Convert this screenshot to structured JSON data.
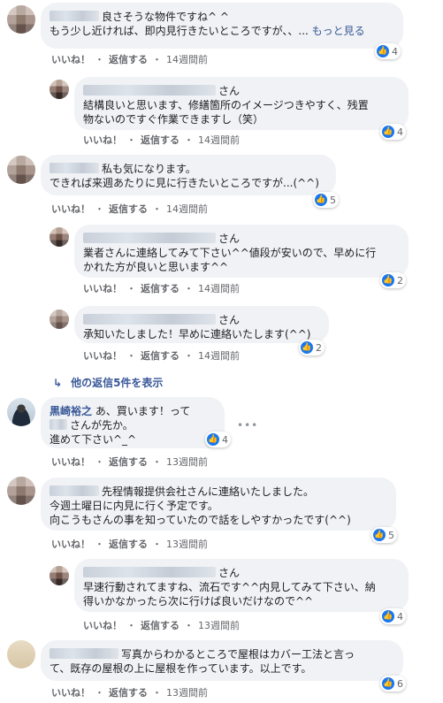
{
  "actions": {
    "like": "いいね！",
    "reply": "返信する",
    "sep": "・"
  },
  "comments": [
    {
      "name": "",
      "lines": [
        "良さそうな物件ですね^ ^",
        "もう少し近ければ、即内見行きたいところですが、、... "
      ],
      "see_more": "もっと見る",
      "likes": "4",
      "time": "14週間前"
    },
    {
      "name": "さん",
      "lines": [
        "結構良いと思います、修繕箇所のイメージつきやすく、残置",
        "物ないのですぐ作業できますし（笑）"
      ],
      "likes": "4",
      "time": "14週間前"
    },
    {
      "name": "",
      "lines": [
        "私も気になります。",
        "できれば来週あたりに見に行きたいところですが...(^^)"
      ],
      "likes": "5",
      "time": "14週間前"
    },
    {
      "name": "さん",
      "lines": [
        "業者さんに連絡してみて下さい^^値段が安いので、早めに行",
        "かれた方が良いと思います^^"
      ],
      "likes": "2",
      "time": "14週間前"
    },
    {
      "name": "さん",
      "lines": [
        "承知いたしました！早めに連絡いたします(^^)"
      ],
      "likes": "2",
      "time": "14週間前"
    },
    {
      "name": "黒崎裕之",
      "lines": [
        "あ、買います！って",
        "さんが先か。",
        "進めて下さい^_^"
      ],
      "likes": "4",
      "time": "13週間前"
    },
    {
      "name": "",
      "lines": [
        "先程情報提供会社さんに連絡いたしました。",
        "今週土曜日に内見に行く予定です。",
        "向こうもさんの事を知っていたので話をしやすかったです(^^)"
      ],
      "likes": "5",
      "time": "13週間前"
    },
    {
      "name": "さん",
      "lines": [
        "早速行動されてますね、流石です^^内見してみて下さい、納",
        "得いかなかったら次に行けば良いだけなので^^"
      ],
      "likes": "4",
      "time": "13週間前"
    },
    {
      "name": "",
      "lines": [
        "写真からわかるところで屋根はカバー工法と言っ",
        "て、既存の屋根の上に屋根を作っています。以上です。"
      ],
      "likes": "6",
      "time": "13週間前"
    }
  ],
  "view_more_replies": "他の返信5件を表示",
  "icons": {
    "like": "thumbs-up-icon",
    "reply_arrow": "reply-arrow-icon",
    "more": "more-options-icon"
  },
  "colors": {
    "bubble": "#f0f2f5",
    "link": "#385898",
    "meta": "#65676b",
    "like_blue": "#1877f2"
  }
}
